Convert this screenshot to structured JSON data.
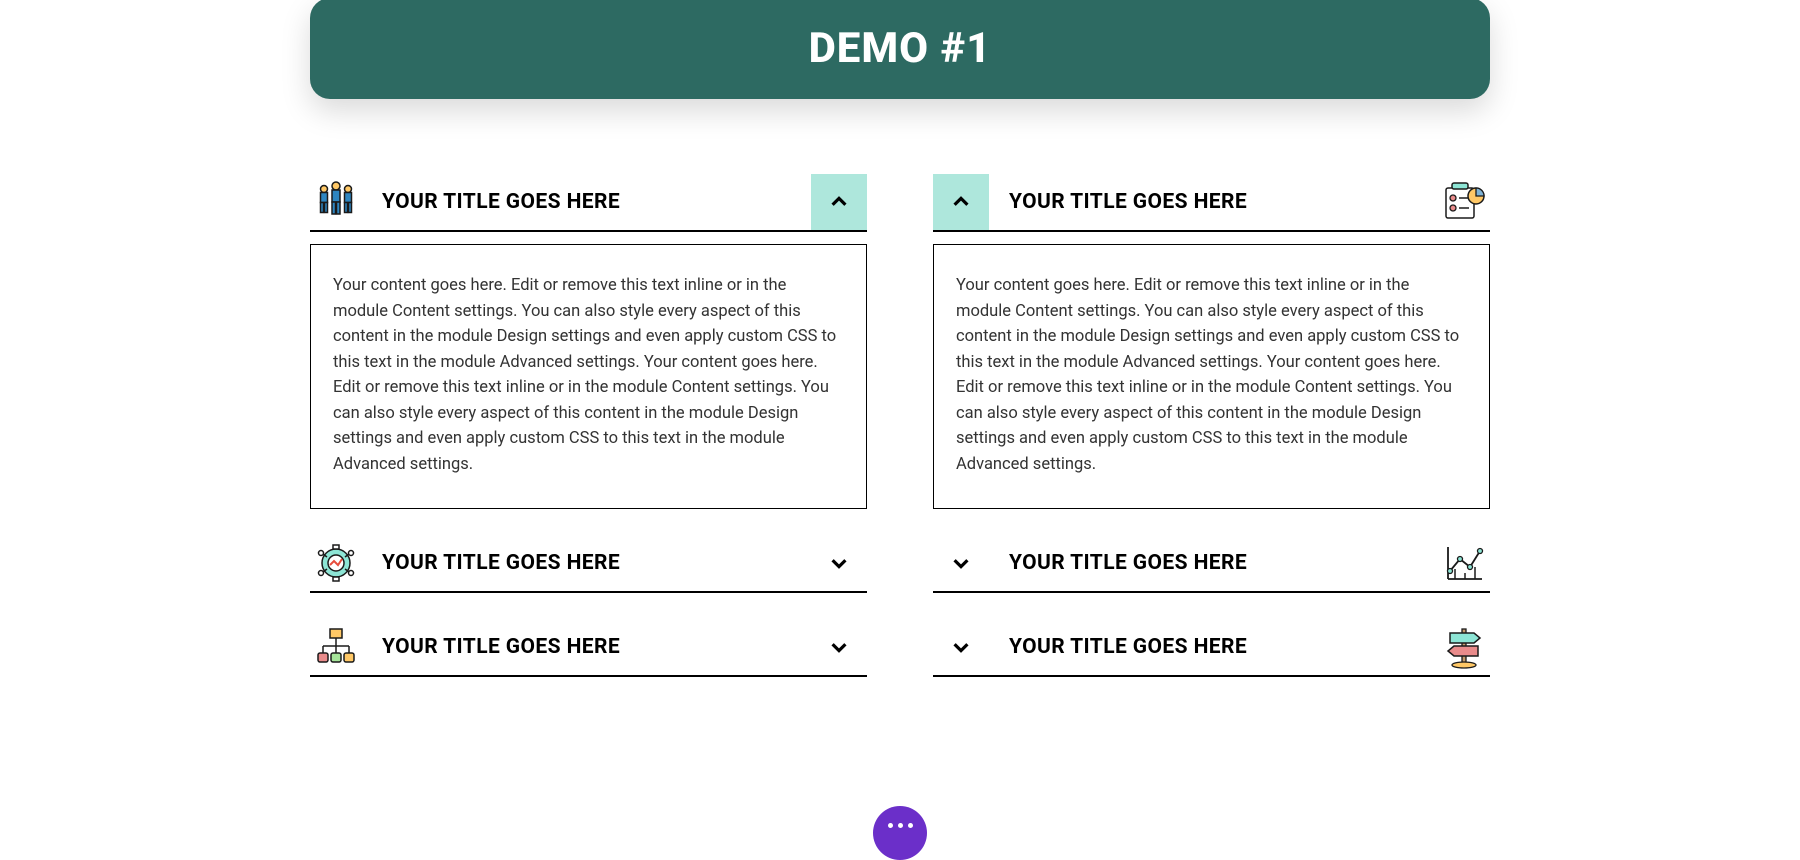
{
  "header": {
    "title": "DEMO #1"
  },
  "columns": {
    "left": {
      "items": [
        {
          "title": "YOUR TITLE GOES HERE",
          "expanded": true,
          "body": "Your content goes here. Edit or remove this text inline or in the module Content settings. You can also style every aspect of this content in the module Design settings and even apply custom CSS to this text in the module Advanced settings. Your content goes here. Edit or remove this text inline or in the module Content settings. You can also style every aspect of this content in the module Design settings and even apply custom CSS to this text in the module Advanced settings."
        },
        {
          "title": "YOUR TITLE GOES HERE",
          "expanded": false
        },
        {
          "title": "YOUR TITLE GOES HERE",
          "expanded": false
        }
      ]
    },
    "right": {
      "items": [
        {
          "title": "YOUR TITLE GOES HERE",
          "expanded": true,
          "body": "Your content goes here. Edit or remove this text inline or in the module Content settings. You can also style every aspect of this content in the module Design settings and even apply custom CSS to this text in the module Advanced settings. Your content goes here. Edit or remove this text inline or in the module Content settings. You can also style every aspect of this content in the module Design settings and even apply custom CSS to this text in the module Advanced settings."
        },
        {
          "title": "YOUR TITLE GOES HERE",
          "expanded": false
        },
        {
          "title": "YOUR TITLE GOES HERE",
          "expanded": false
        }
      ]
    }
  },
  "icons": {
    "left": [
      "team-icon",
      "gear-analytics-icon",
      "flowchart-icon"
    ],
    "right": [
      "planning-board-icon",
      "line-chart-icon",
      "signpost-icon"
    ]
  },
  "colors": {
    "header_bg": "#2d6a62",
    "toggle_open_bg": "#aee7dc",
    "fab_bg": "#6b2fc9"
  }
}
